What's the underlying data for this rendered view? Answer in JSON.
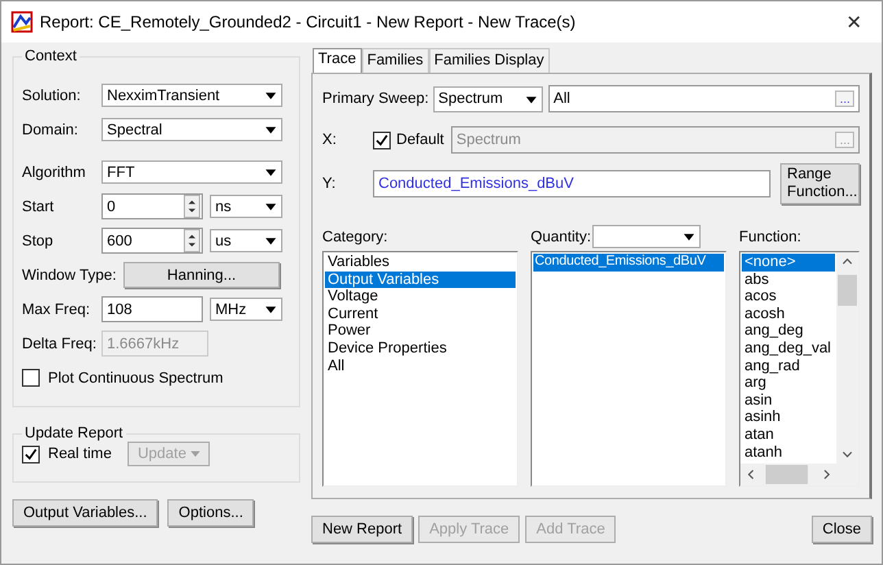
{
  "window": {
    "title": "Report: CE_Remotely_Grounded2 - Circuit1 - New Report - New Trace(s)",
    "close": "✕"
  },
  "context": {
    "label": "Context",
    "rows": [
      {
        "kind": "combo",
        "label": "Solution:",
        "value": "NexximTransient"
      },
      {
        "kind": "combo",
        "label": "Domain:",
        "value": "Spectral"
      },
      {
        "kind": "combo",
        "label": "Algorithm",
        "value": "FFT"
      },
      {
        "kind": "spin",
        "label": "Start",
        "value": "0",
        "unit": "ns"
      },
      {
        "kind": "spin",
        "label": "Stop",
        "value": "600",
        "unit": "us"
      },
      {
        "kind": "button",
        "label": "Window Type:",
        "value": "Hanning..."
      },
      {
        "kind": "text",
        "label": "Max Freq:",
        "value": "108",
        "unit": "MHz",
        "disabled": false
      },
      {
        "kind": "text",
        "label": "Delta Freq:",
        "value": "1.6667kHz",
        "disabled": true
      },
      {
        "kind": "check",
        "label": "Plot Continuous Spectrum",
        "checked": false
      }
    ]
  },
  "update_report": {
    "label": "Update Report",
    "real_time": {
      "label": "Real time",
      "checked": true
    },
    "update_button": {
      "label": "Update",
      "disabled": true
    }
  },
  "tabs": [
    {
      "label": "Trace",
      "selected": true
    },
    {
      "label": "Families",
      "selected": false
    },
    {
      "label": "Families Display",
      "selected": false
    }
  ],
  "trace": {
    "primary_sweep": {
      "label": "Primary Sweep:",
      "value": "Spectrum",
      "range": "All",
      "range_button": "..."
    },
    "x": {
      "label": "X:",
      "default_label": "Default",
      "default_checked": true,
      "value": "Spectrum",
      "value_disabled": true,
      "button": "..."
    },
    "y": {
      "label": "Y:",
      "value": "Conducted_Emissions_dBuV",
      "range_button": "Range Function..."
    },
    "category": {
      "label": "Category:",
      "items": [
        {
          "label": "Variables",
          "selected": false
        },
        {
          "label": "Output Variables",
          "selected": true
        },
        {
          "label": "Voltage",
          "selected": false
        },
        {
          "label": "Current",
          "selected": false
        },
        {
          "label": "Power",
          "selected": false
        },
        {
          "label": "Device Properties",
          "selected": false
        },
        {
          "label": "All",
          "selected": false
        }
      ]
    },
    "quantity": {
      "label": "Quantity:",
      "items": [
        {
          "label": "Conducted_Emissions_dBuV",
          "selected": true
        }
      ]
    },
    "function": {
      "label": "Function:",
      "items": [
        {
          "label": "<none>",
          "selected": true
        },
        {
          "label": "abs",
          "selected": false
        },
        {
          "label": "acos",
          "selected": false
        },
        {
          "label": "acosh",
          "selected": false
        },
        {
          "label": "ang_deg",
          "selected": false
        },
        {
          "label": "ang_deg_val",
          "selected": false
        },
        {
          "label": "ang_rad",
          "selected": false
        },
        {
          "label": "arg",
          "selected": false
        },
        {
          "label": "asin",
          "selected": false
        },
        {
          "label": "asinh",
          "selected": false
        },
        {
          "label": "atan",
          "selected": false
        },
        {
          "label": "atanh",
          "selected": false
        }
      ]
    }
  },
  "left_buttons": [
    {
      "label": "Output Variables...",
      "disabled": false
    },
    {
      "label": "Options...",
      "disabled": false
    }
  ],
  "right_buttons": [
    {
      "label": "New Report",
      "disabled": false
    },
    {
      "label": "Apply Trace",
      "disabled": true
    },
    {
      "label": "Add Trace",
      "disabled": true
    }
  ],
  "close_button": {
    "label": "Close",
    "disabled": false
  }
}
